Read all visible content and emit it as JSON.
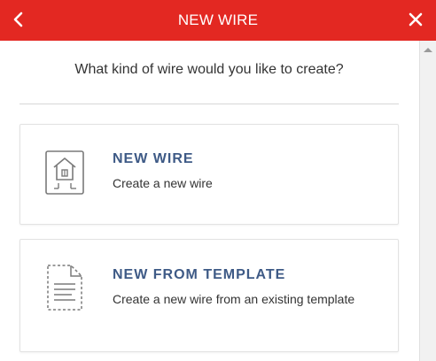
{
  "header": {
    "title": "NEW WIRE",
    "back_icon": "chevron-left-icon",
    "close_icon": "close-icon",
    "color": "#e32822"
  },
  "prompt": "What kind of wire would you like to create?",
  "options": [
    {
      "title": "NEW WIRE",
      "description": "Create a new wire",
      "icon": "house-document-icon"
    },
    {
      "title": "NEW FROM TEMPLATE",
      "description": "Create a new wire from an existing template",
      "icon": "template-document-icon"
    }
  ],
  "accent_color": "#3e5a86"
}
